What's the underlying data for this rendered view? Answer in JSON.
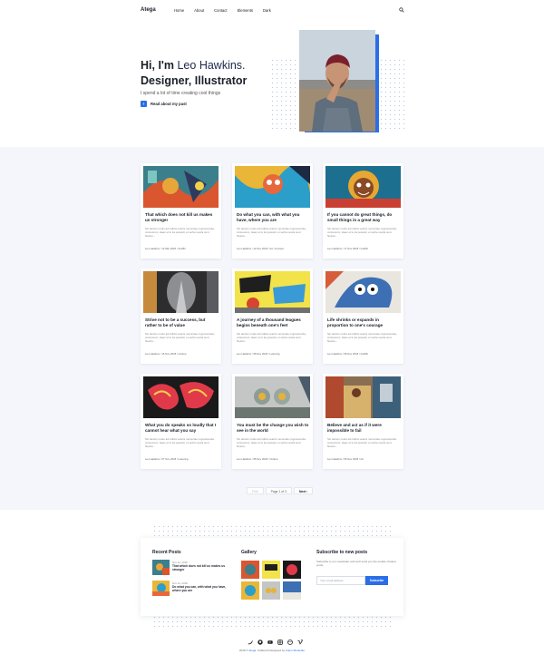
{
  "nav": {
    "brand": "Atega",
    "items": [
      "Home",
      "About",
      "Contact",
      "Elements",
      "Dark"
    ]
  },
  "hero": {
    "line1_prefix": "Hi, I'm ",
    "name": "Leo Hawkins.",
    "line2": "Designer, Illustrator",
    "subtitle": "I spend a lot of time creating cool things",
    "cta_label": "Read about my past"
  },
  "posts": [
    {
      "title": "That which does not kill us makes us stronger",
      "excerpt": "Sin tantum modo ad indicia veteris memoriae cognoscenda, curiosorum. Haec et tu ita posuisti, et verba vestra sunt. Nescio...",
      "meta": "Leo Hawkins / 12 Mar 2018 / Graffiti"
    },
    {
      "title": "Do what you can, with what you have, where you are",
      "excerpt": "Sin tantum modo ad indicia veteris memoriae cognoscenda, curiosorum. Haec et tu ita posuisti, et verba vestra sunt. Nescio...",
      "meta": "Leo Hawkins / 12 Nov 2018 / Art, Concept"
    },
    {
      "title": "If you cannot do great things, do small things in a great way",
      "excerpt": "Sin tantum modo ad indicia veteris memoriae cognoscenda, curiosorum. Haec et tu ita posuisti, et verba vestra sunt. Nescio...",
      "meta": "Leo Hawkins / 17 Nov 2018 / Graffiti"
    },
    {
      "title": "Strive not to be a success, but rather to be of value",
      "excerpt": "Sin tantum modo ad indicia veteris memoriae cognoscenda, curiosorum. Haec et tu ita posuisti, et verba vestra sunt. Nescio...",
      "meta": "Leo Hawkins / 16 Nov 2018 / Culture"
    },
    {
      "title": "A journey of a thousand leagues begins beneath one's feet",
      "excerpt": "Sin tantum modo ad indicia veteris memoriae cognoscenda, curiosorum. Haec et tu ita posuisti, et verba vestra sunt. Nescio...",
      "meta": "Leo Hawkins / 08 Nov 2018 / Lettering"
    },
    {
      "title": "Life shrinks or expands in proportion to one's courage",
      "excerpt": "Sin tantum modo ad indicia veteris memoriae cognoscenda, curiosorum. Haec et tu ita posuisti, et verba vestra sunt. Nescio...",
      "meta": "Leo Hawkins / 08 Nov 2018 / Graffiti"
    },
    {
      "title": "What you do speaks so loudly that I cannot hear what you say",
      "excerpt": "Sin tantum modo ad indicia veteris memoriae cognoscenda, curiosorum. Haec et tu ita posuisti, et verba vestra sunt. Nescio...",
      "meta": "Leo Hawkins / 07 Nov 2018 / Lettering"
    },
    {
      "title": "You must be the change you wish to see in the world",
      "excerpt": "Sin tantum modo ad indicia veteris memoriae cognoscenda, curiosorum. Haec et tu ita posuisti, et verba vestra sunt. Nescio...",
      "meta": "Leo Hawkins / 08 Nov 2018 / Culture"
    },
    {
      "title": "Believe and act as if it were impossible to fail",
      "excerpt": "Sin tantum modo ad indicia veteris memoriae cognoscenda, curiosorum. Haec et tu ita posuisti, et verba vestra sunt. Nescio...",
      "meta": "Leo Hawkins / 06 Nov 2018 / Art"
    }
  ],
  "pagination": {
    "first": "First",
    "page": "Page 1 of 3",
    "next": "Next"
  },
  "footer": {
    "recent_title": "Recent Posts",
    "recent": [
      {
        "date": "Nov 12, 2018",
        "title": "That which does not kill us makes us stronger"
      },
      {
        "date": "Nov 12, 2018",
        "title": "Do what you can, with what you have, where you are"
      }
    ],
    "gallery_title": "Gallery",
    "subscribe_title": "Subscribe to new posts",
    "subscribe_text": "Subscribe to our newsletter and we'll send you the emails of latest posts.",
    "email_placeholder": "Your email address",
    "subscribe_button": "Subscribe",
    "social_icons": [
      "twitter-icon",
      "github-icon",
      "youtube-icon",
      "instagram-icon",
      "dribbble-icon",
      "vimeo-icon"
    ],
    "copyright_prefix": "2018 © ",
    "copyright_brand": "Atega",
    "copyright_mid": ". Crafted & Designed by ",
    "copyright_author": "Artem Sheludko"
  },
  "colors": {
    "accent": "#2a6ee8",
    "background": "#f4f6fb",
    "text": "#1b1f29"
  }
}
